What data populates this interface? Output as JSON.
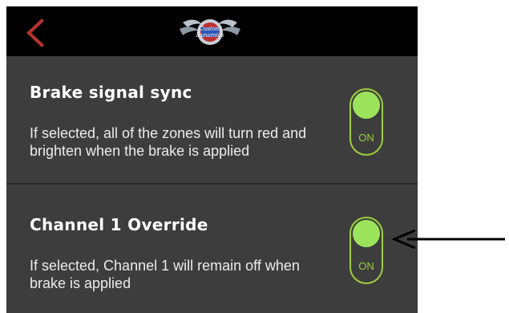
{
  "header": {
    "logo_text_line1": "Custom",
    "logo_text_line2": "Dynamics"
  },
  "settings": [
    {
      "title": "Brake signal sync",
      "description": "If selected, all of the zones will turn red and brighten when the brake is applied",
      "toggle_label": "ON",
      "enabled": true
    },
    {
      "title": "Channel 1 Override",
      "description": "If selected, Channel 1 will remain off when brake is applied",
      "toggle_label": "ON",
      "enabled": true
    }
  ],
  "colors": {
    "background": "#3d3d3d",
    "header": "#000000",
    "back_chevron": "#b8352c",
    "toggle_border": "#9ccf3a",
    "toggle_knob": "#9be35a"
  }
}
